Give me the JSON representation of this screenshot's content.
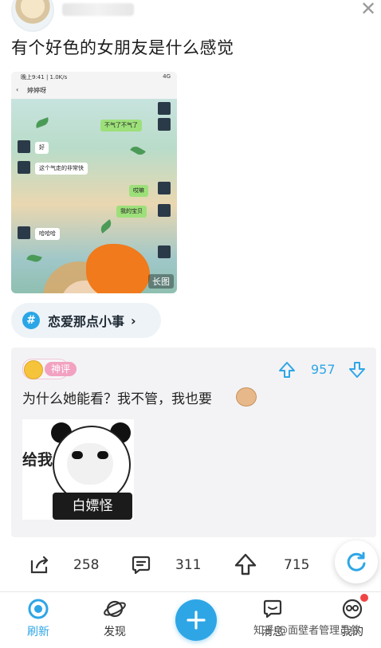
{
  "post": {
    "close_icon": "close-icon",
    "title": "有个好色的女朋友是什么感觉",
    "image": {
      "status_time": "晚上9:41 | 1.0K/s",
      "status_right": "4G",
      "back_icon": "chevron-left-icon",
      "chat_name": "婷婷呀",
      "badge": "长图",
      "bubbles": [
        {
          "side": "right",
          "text": "不气了不气了"
        },
        {
          "side": "left",
          "text": "好"
        },
        {
          "side": "left",
          "text": "这个气走的非常快"
        },
        {
          "side": "right",
          "text": "哎嘛"
        },
        {
          "side": "right",
          "text": "我的宝贝"
        },
        {
          "side": "left",
          "text": "哈哈哈"
        }
      ]
    }
  },
  "topic": {
    "icon": "hash-icon",
    "label": "恋爱那点小事",
    "chevron": "›"
  },
  "god_comment": {
    "badge": "神评",
    "vote_count": "957",
    "text": "为什么她能看？我不管，我也要",
    "meme": {
      "side_text": "给我",
      "caption": "白嫖怪"
    }
  },
  "actions": {
    "share_count": "258",
    "comment_count": "311",
    "upvote_count": "715"
  },
  "bottom_nav": {
    "items": [
      {
        "label": "刷新",
        "icon": "refresh-icon",
        "active": true
      },
      {
        "label": "发现",
        "icon": "planet-icon",
        "active": false
      },
      {
        "label": "消息",
        "icon": "message-icon",
        "active": false
      },
      {
        "label": "我的",
        "icon": "profile-icon",
        "active": false
      }
    ],
    "post_icon": "plus-icon"
  },
  "watermark": "知乎 @面壁者管理员敛",
  "colors": {
    "accent": "#2ea6e6",
    "god_badge": "#f2a2c0",
    "card_bg": "#f3f3f5"
  }
}
